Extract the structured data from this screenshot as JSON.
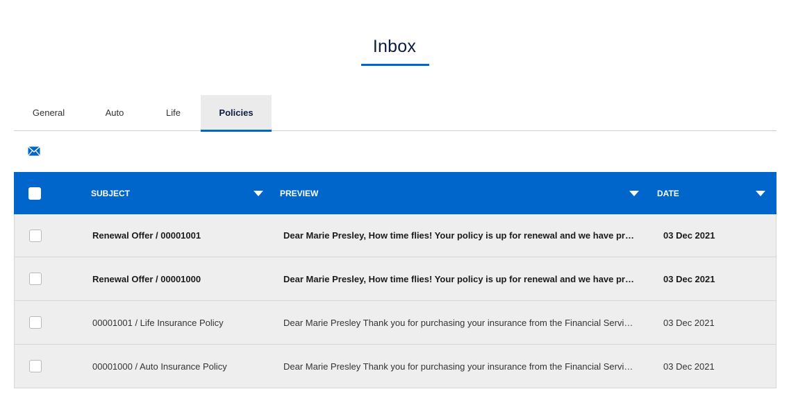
{
  "page": {
    "title": "Inbox"
  },
  "tabs": [
    {
      "label": "General",
      "active": false
    },
    {
      "label": "Auto",
      "active": false
    },
    {
      "label": "Life",
      "active": false
    },
    {
      "label": "Policies",
      "active": true
    }
  ],
  "toolbar": {
    "compose_icon": "envelope-icon"
  },
  "table": {
    "columns": [
      "SUBJECT",
      "PREVIEW",
      "DATE"
    ],
    "rows": [
      {
        "subject": "Renewal Offer / 00001001",
        "preview": "Dear Marie Presley, How time flies! Your policy is up for renewal and we have prepared a renewal offer for you.",
        "date": "03 Dec 2021",
        "unread": true
      },
      {
        "subject": "Renewal Offer / 00001000",
        "preview": "Dear Marie Presley, How time flies! Your policy is up for renewal and we have prepared a renewal offer for you.",
        "date": "03 Dec 2021",
        "unread": true
      },
      {
        "subject": "00001001 / Life Insurance Policy",
        "preview": "Dear Marie Presley Thank you for purchasing your insurance from the Financial Services company.",
        "date": "03 Dec 2021",
        "unread": false
      },
      {
        "subject": "00001000 / Auto Insurance Policy",
        "preview": "Dear Marie Presley Thank you for purchasing your insurance from the Financial Services company.",
        "date": "03 Dec 2021",
        "unread": false
      }
    ]
  },
  "colors": {
    "accent": "#0066cc",
    "row_bg": "#eeeeee",
    "title": "#0d1b3e"
  }
}
